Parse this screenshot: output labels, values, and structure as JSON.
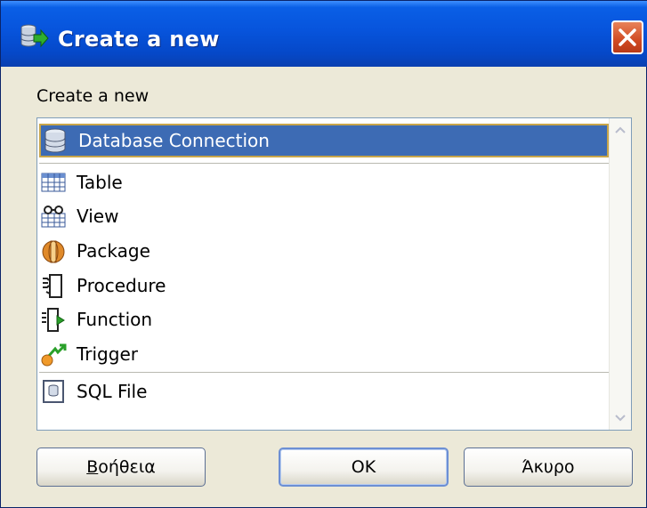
{
  "window": {
    "title": "Create a new",
    "close_label": "Close"
  },
  "body": {
    "label": "Create a new"
  },
  "list": {
    "items": [
      {
        "label": "Database Connection",
        "icon": "database-icon",
        "selected": true
      },
      {
        "label": "Table",
        "icon": "table-icon"
      },
      {
        "label": "View",
        "icon": "view-icon"
      },
      {
        "label": "Package",
        "icon": "package-icon"
      },
      {
        "label": "Procedure",
        "icon": "procedure-icon"
      },
      {
        "label": "Function",
        "icon": "function-icon"
      },
      {
        "label": "Trigger",
        "icon": "trigger-icon"
      },
      {
        "label": "SQL File",
        "icon": "sql-file-icon"
      }
    ]
  },
  "buttons": {
    "help_first": "Β",
    "help_rest": "οήθεια",
    "ok": "OK",
    "cancel": "Άκυρο"
  },
  "colors": {
    "titlebar": "#0754dc",
    "selection": "#3d6bb4",
    "dialog_bg": "#ece9d8"
  }
}
